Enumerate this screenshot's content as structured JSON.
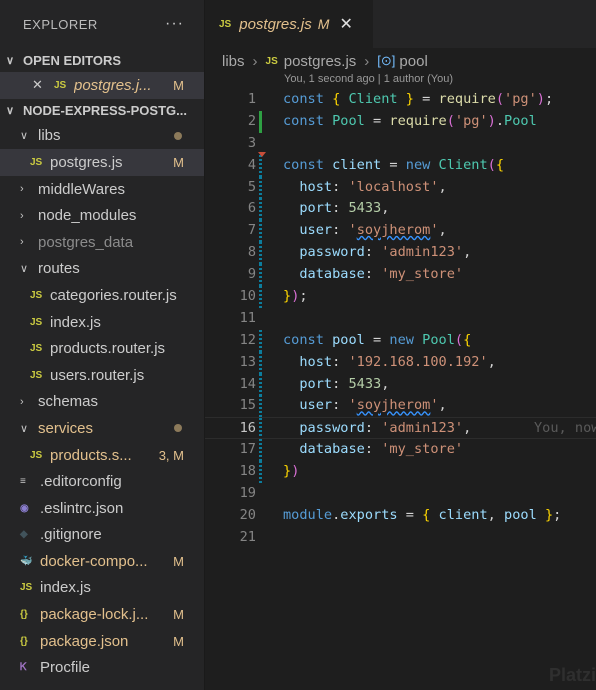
{
  "explorer": {
    "title": "EXPLORER",
    "more": "···",
    "open_editors": {
      "label": "OPEN EDITORS",
      "items": [
        {
          "close": "✕",
          "type": "JS",
          "name": "postgres.j...",
          "status": "M"
        }
      ]
    },
    "project": {
      "label": "NODE-EXPRESS-POSTG...",
      "tree": [
        {
          "kind": "folder",
          "chev": "∨",
          "name": "libs",
          "dot": true,
          "depth": 1
        },
        {
          "kind": "file",
          "icon": "JS",
          "name": "postgres.js",
          "status": "M",
          "depth": 2,
          "active": true
        },
        {
          "kind": "folder",
          "chev": "›",
          "name": "middleWares",
          "depth": 1
        },
        {
          "kind": "folder",
          "chev": "›",
          "name": "node_modules",
          "depth": 1
        },
        {
          "kind": "folder",
          "chev": "›",
          "name": "postgres_data",
          "depth": 1,
          "dim": true
        },
        {
          "kind": "folder",
          "chev": "∨",
          "name": "routes",
          "depth": 1
        },
        {
          "kind": "file",
          "icon": "JS",
          "name": "categories.router.js",
          "depth": 2
        },
        {
          "kind": "file",
          "icon": "JS",
          "name": "index.js",
          "depth": 2
        },
        {
          "kind": "file",
          "icon": "JS",
          "name": "products.router.js",
          "depth": 2
        },
        {
          "kind": "file",
          "icon": "JS",
          "name": "users.router.js",
          "depth": 2
        },
        {
          "kind": "folder",
          "chev": "›",
          "name": "schemas",
          "depth": 1
        },
        {
          "kind": "folder",
          "chev": "∨",
          "name": "services",
          "dot": true,
          "depth": 1,
          "mod": true
        },
        {
          "kind": "file",
          "icon": "JS",
          "name": "products.s...",
          "status": "3, M",
          "depth": 2,
          "mod": true
        },
        {
          "kind": "file",
          "icon": "≡",
          "name": ".editorconfig",
          "depth": 1
        },
        {
          "kind": "file",
          "icon": "◉",
          "name": ".eslintrc.json",
          "depth": 1
        },
        {
          "kind": "file",
          "icon": "◆",
          "name": ".gitignore",
          "depth": 1
        },
        {
          "kind": "file",
          "icon": "🐳",
          "name": "docker-compo...",
          "status": "M",
          "depth": 1,
          "mod": true
        },
        {
          "kind": "file",
          "icon": "JS",
          "name": "index.js",
          "depth": 1
        },
        {
          "kind": "file",
          "icon": "{}",
          "name": "package-lock.j...",
          "status": "M",
          "depth": 1,
          "mod": true
        },
        {
          "kind": "file",
          "icon": "{}",
          "name": "package.json",
          "status": "M",
          "depth": 1,
          "mod": true
        },
        {
          "kind": "file",
          "icon": "Ꮶ",
          "name": "Procfile",
          "depth": 1
        }
      ]
    }
  },
  "tab": {
    "type": "JS",
    "name": "postgres.js",
    "status": "M",
    "close": "✕"
  },
  "breadcrumb": {
    "folder": "libs",
    "file": "postgres.js",
    "symbol": "pool"
  },
  "codelens": "You, 1 second ago | 1 author (You)",
  "editor": {
    "current_line": 16,
    "ghost_text": "You, now",
    "lines": [
      "const { Client } = require('pg');",
      "const Pool = require('pg').Pool",
      "",
      "const client = new Client({",
      "  host: 'localhost',",
      "  port: 5433,",
      "  user: 'soyjherom',",
      "  password: 'admin123',",
      "  database: 'my_store'",
      "});",
      "",
      "const pool = new Pool({",
      "  host: '192.168.100.192',",
      "  port: 5433,",
      "  user: 'soyjherom',",
      "  password: 'admin123',",
      "  database: 'my_store'",
      "})",
      "",
      "module.exports = { client, pool };",
      ""
    ]
  },
  "watermark": "Platzi"
}
